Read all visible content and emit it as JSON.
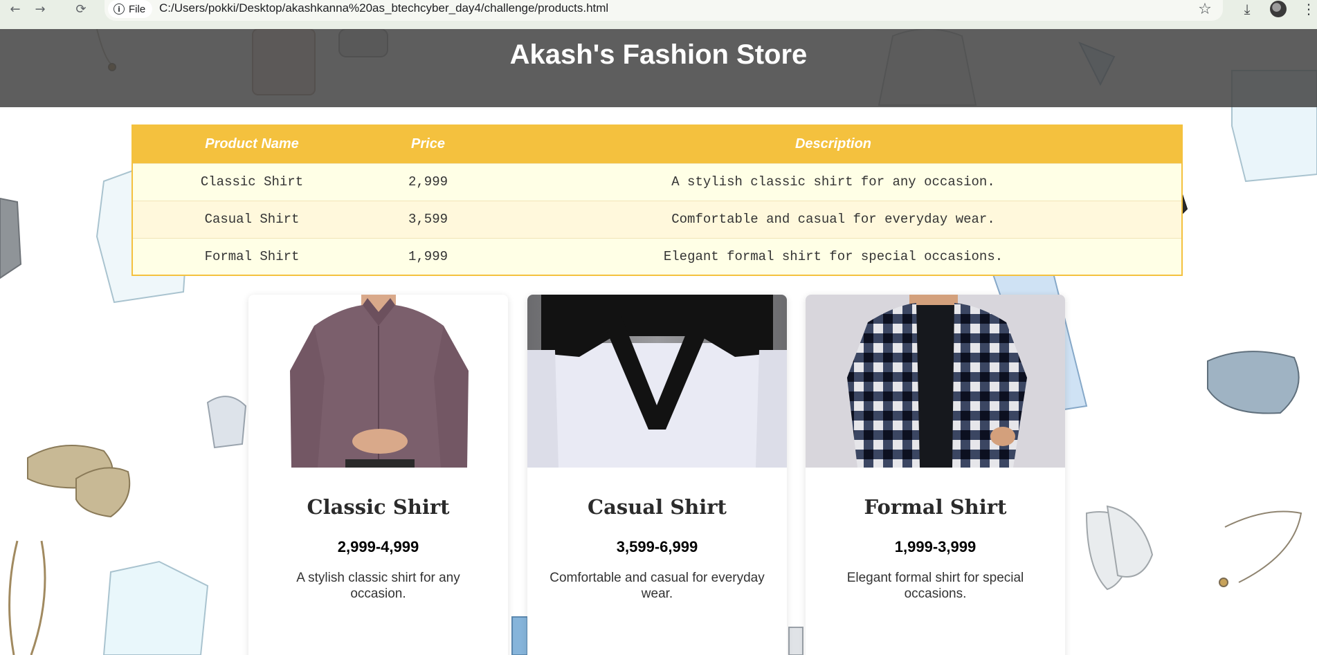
{
  "browser": {
    "file_chip_label": "File",
    "url": "C:/Users/pokki/Desktop/akashkanna%20as_btechcyber_day4/challenge/products.html"
  },
  "header": {
    "title": "Akash's Fashion Store"
  },
  "table": {
    "headers": [
      "Product Name",
      "Price",
      "Description"
    ],
    "rows": [
      {
        "name": "Classic Shirt",
        "price": "2,999",
        "description": "A stylish classic shirt for any occasion."
      },
      {
        "name": "Casual Shirt",
        "price": "3,599",
        "description": "Comfortable and casual for everyday wear."
      },
      {
        "name": "Formal Shirt",
        "price": "1,999",
        "description": "Elegant formal shirt for special occasions."
      }
    ]
  },
  "cards": [
    {
      "title": "Classic Shirt",
      "price": "2,999-4,999",
      "description": "A stylish classic shirt for any occasion."
    },
    {
      "title": "Casual Shirt",
      "price": "3,599-6,999",
      "description": "Comfortable and casual for everyday wear."
    },
    {
      "title": "Formal Shirt",
      "price": "1,999-3,999",
      "description": "Elegant formal shirt for special occasions."
    }
  ],
  "colors": {
    "header_bg": "#444444",
    "table_header_bg": "#f4c13e",
    "table_row_odd": "#ffffe6",
    "table_row_even": "#fff8dc"
  }
}
